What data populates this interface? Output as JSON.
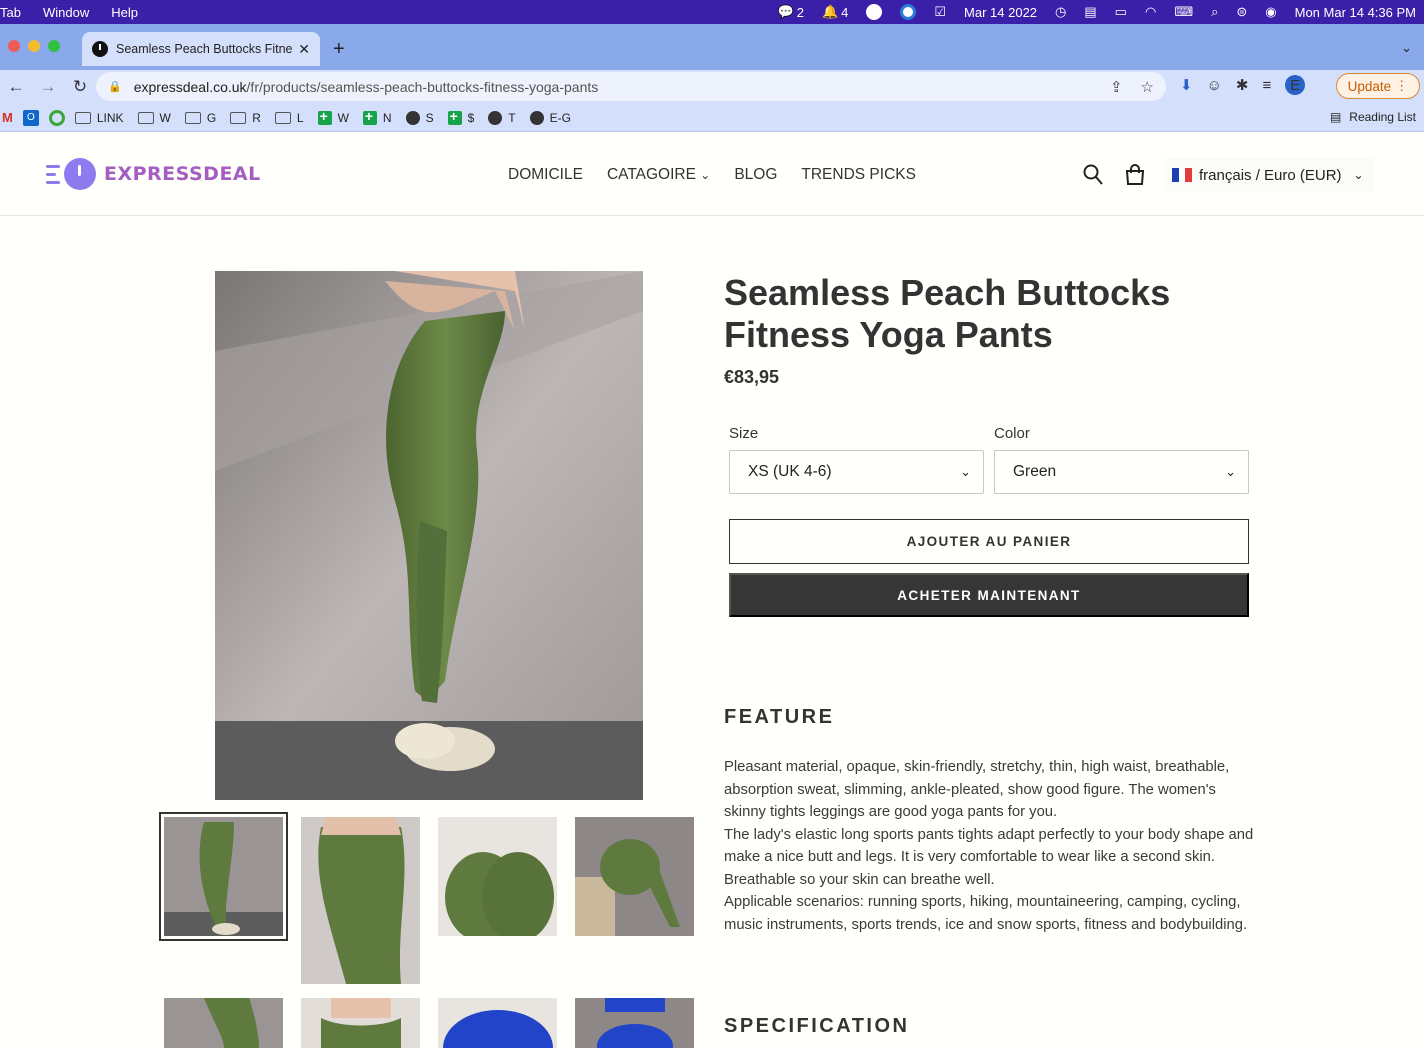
{
  "menubar": {
    "items": [
      "Tab",
      "Window",
      "Help"
    ],
    "wechat_count": "2",
    "notification_count": "4",
    "date_short": "Mar 14 2022",
    "datetime": "Mon Mar 14  4:36 PM"
  },
  "browser": {
    "tab_title": "Seamless Peach Buttocks Fitne",
    "url_domain": "expressdeal.co.uk",
    "url_path": "/fr/products/seamless-peach-buttocks-fitness-yoga-pants",
    "update_label": "Update",
    "profile_initial": "E",
    "bookmarks": [
      {
        "label": "LINK",
        "icon": "folder"
      },
      {
        "label": "W",
        "icon": "folder"
      },
      {
        "label": "G",
        "icon": "folder"
      },
      {
        "label": "R",
        "icon": "folder"
      },
      {
        "label": "L",
        "icon": "folder"
      },
      {
        "label": "W",
        "icon": "sheets"
      },
      {
        "label": "N",
        "icon": "sheets"
      },
      {
        "label": "S",
        "icon": "globe"
      },
      {
        "label": "$",
        "icon": "sheets"
      },
      {
        "label": "T",
        "icon": "globe"
      },
      {
        "label": "E-G",
        "icon": "globe"
      }
    ],
    "reading_list_label": "Reading List"
  },
  "site": {
    "logo_text": "EXPRESSDEAL",
    "nav": {
      "home": "DOMICILE",
      "category": "CATAGOIRE",
      "blog": "BLOG",
      "trends": "TRENDS PICKS"
    },
    "locale_label": "français / Euro (EUR)"
  },
  "product": {
    "title": "Seamless Peach Buttocks Fitness Yoga Pants",
    "price": "€83,95",
    "size_label": "Size",
    "size_value": "XS (UK 4-6)",
    "color_label": "Color",
    "color_value": "Green",
    "add_to_cart": "AJOUTER AU PANIER",
    "buy_now": "ACHETER MAINTENANT",
    "feature_heading": "FEATURE",
    "feature_paragraphs": [
      "Pleasant material, opaque, skin-friendly, stretchy, thin, high waist, breathable, absorption sweat, slimming, ankle-pleated, show good figure. The women's skinny tights leggings are good yoga pants for you.",
      "The lady's elastic long sports pants tights adapt perfectly to your body shape and make a nice butt and legs. It is very comfortable to wear like a second skin. Breathable so your skin can breathe well.",
      "Applicable scenarios: running sports, hiking, mountaineering, camping, cycling, music instruments, sports trends, ice and snow sports, fitness and bodybuilding."
    ],
    "spec_heading": "SPECIFICATION"
  },
  "colors": {
    "menubar": "#3a1fa8",
    "browser_chrome": "#d4e0fb",
    "logo_purple": "#a45ec2",
    "leggings_green": "#5f7a3e",
    "leggings_blue": "#2244c8",
    "button_dark": "#363636"
  }
}
